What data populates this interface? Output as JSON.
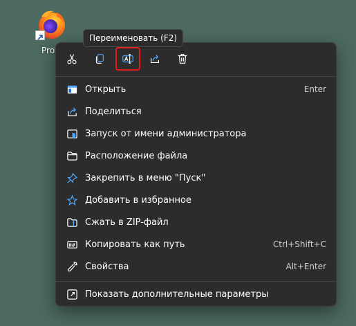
{
  "desktop": {
    "icon_label": "Prox",
    "icon_name": "firefox-icon"
  },
  "tooltip": {
    "text": "Переименовать (F2)"
  },
  "toolbar": {
    "buttons": [
      {
        "name": "cut",
        "icon": "scissors-icon"
      },
      {
        "name": "copy",
        "icon": "copy-icon"
      },
      {
        "name": "rename",
        "icon": "rename-icon",
        "highlighted": true
      },
      {
        "name": "share",
        "icon": "share-icon"
      },
      {
        "name": "delete",
        "icon": "trash-icon"
      }
    ]
  },
  "menu": {
    "items": [
      {
        "label": "Открыть",
        "shortcut": "Enter",
        "icon": "open-window-icon"
      },
      {
        "label": "Поделиться",
        "shortcut": "",
        "icon": "share-icon"
      },
      {
        "label": "Запуск от имени администратора",
        "shortcut": "",
        "icon": "shield-icon"
      },
      {
        "label": "Расположение файла",
        "shortcut": "",
        "icon": "folder-icon"
      },
      {
        "label": "Закрепить в меню \"Пуск\"",
        "shortcut": "",
        "icon": "pin-icon"
      },
      {
        "label": "Добавить в избранное",
        "shortcut": "",
        "icon": "star-icon"
      },
      {
        "label": "Сжать в ZIP-файл",
        "shortcut": "",
        "icon": "zip-folder-icon"
      },
      {
        "label": "Копировать как путь",
        "shortcut": "Ctrl+Shift+C",
        "icon": "copy-path-icon"
      },
      {
        "label": "Свойства",
        "shortcut": "Alt+Enter",
        "icon": "wrench-icon"
      }
    ],
    "more": {
      "label": "Показать дополнительные параметры",
      "icon": "more-options-icon"
    }
  },
  "colors": {
    "desktop_bg": "#4c6a5f",
    "menu_bg": "#2c2c2c",
    "accent_blue": "#4ea8ff",
    "highlight_red": "#e31b1b"
  }
}
